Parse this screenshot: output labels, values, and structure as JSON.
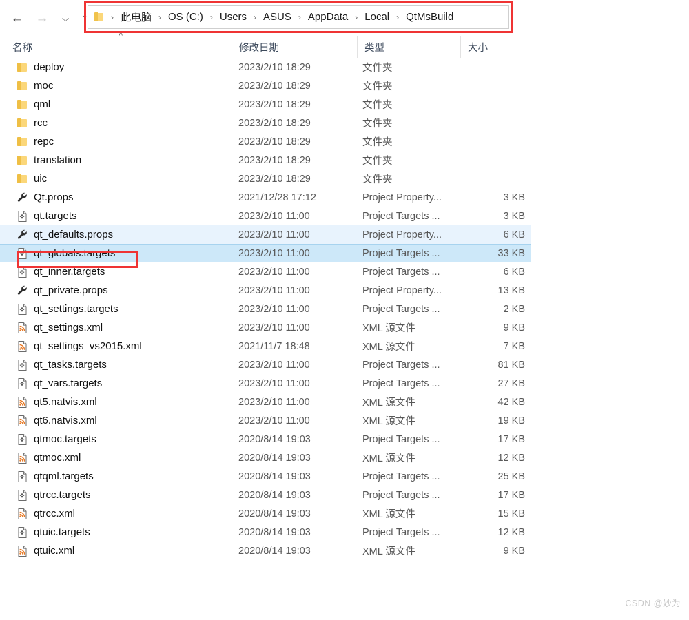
{
  "nav": {
    "back_icon": "arrow-left-icon",
    "forward_icon": "arrow-right-icon",
    "recent_icon": "chevron-down-icon",
    "up_icon": "arrow-up-icon",
    "back_label": "←",
    "forward_label": "→",
    "recent_label": "⌵",
    "up_label": "↑"
  },
  "address": {
    "folder_icon": "folder-icon",
    "separator": "›",
    "crumbs": [
      {
        "label": "此电脑"
      },
      {
        "label": "OS (C:)"
      },
      {
        "label": "Users"
      },
      {
        "label": "ASUS"
      },
      {
        "label": "AppData"
      },
      {
        "label": "Local"
      },
      {
        "label": "QtMsBuild"
      }
    ]
  },
  "columns": {
    "name": "名称",
    "date": "修改日期",
    "type": "类型",
    "size": "大小",
    "sort_caret": "˄"
  },
  "rows": [
    {
      "name": "deploy",
      "date": "2023/2/10 18:29",
      "type": "文件夹",
      "size": "",
      "icon": "folder-icon",
      "kind": "folder",
      "selected": "none"
    },
    {
      "name": "moc",
      "date": "2023/2/10 18:29",
      "type": "文件夹",
      "size": "",
      "icon": "folder-icon",
      "kind": "folder",
      "selected": "none"
    },
    {
      "name": "qml",
      "date": "2023/2/10 18:29",
      "type": "文件夹",
      "size": "",
      "icon": "folder-icon",
      "kind": "folder",
      "selected": "none"
    },
    {
      "name": "rcc",
      "date": "2023/2/10 18:29",
      "type": "文件夹",
      "size": "",
      "icon": "folder-icon",
      "kind": "folder",
      "selected": "none"
    },
    {
      "name": "repc",
      "date": "2023/2/10 18:29",
      "type": "文件夹",
      "size": "",
      "icon": "folder-icon",
      "kind": "folder",
      "selected": "none"
    },
    {
      "name": "translation",
      "date": "2023/2/10 18:29",
      "type": "文件夹",
      "size": "",
      "icon": "folder-icon",
      "kind": "folder",
      "selected": "none"
    },
    {
      "name": "uic",
      "date": "2023/2/10 18:29",
      "type": "文件夹",
      "size": "",
      "icon": "folder-icon",
      "kind": "folder",
      "selected": "none"
    },
    {
      "name": "Qt.props",
      "date": "2021/12/28 17:12",
      "type": "Project Property...",
      "size": "3 KB",
      "icon": "wrench-icon",
      "kind": "props",
      "selected": "none"
    },
    {
      "name": "qt.targets",
      "date": "2023/2/10 11:00",
      "type": "Project Targets ...",
      "size": "3 KB",
      "icon": "targets-file-icon",
      "kind": "targets",
      "selected": "none"
    },
    {
      "name": "qt_defaults.props",
      "date": "2023/2/10 11:00",
      "type": "Project Property...",
      "size": "6 KB",
      "icon": "wrench-icon",
      "kind": "props",
      "selected": "light"
    },
    {
      "name": "qt_globals.targets",
      "date": "2023/2/10 11:00",
      "type": "Project Targets ...",
      "size": "33 KB",
      "icon": "targets-file-icon",
      "kind": "targets",
      "selected": "strong"
    },
    {
      "name": "qt_inner.targets",
      "date": "2023/2/10 11:00",
      "type": "Project Targets ...",
      "size": "6 KB",
      "icon": "targets-file-icon",
      "kind": "targets",
      "selected": "none"
    },
    {
      "name": "qt_private.props",
      "date": "2023/2/10 11:00",
      "type": "Project Property...",
      "size": "13 KB",
      "icon": "wrench-icon",
      "kind": "props",
      "selected": "none"
    },
    {
      "name": "qt_settings.targets",
      "date": "2023/2/10 11:00",
      "type": "Project Targets ...",
      "size": "2 KB",
      "icon": "targets-file-icon",
      "kind": "targets",
      "selected": "none"
    },
    {
      "name": "qt_settings.xml",
      "date": "2023/2/10 11:00",
      "type": "XML 源文件",
      "size": "9 KB",
      "icon": "xml-file-icon",
      "kind": "xml",
      "selected": "none"
    },
    {
      "name": "qt_settings_vs2015.xml",
      "date": "2021/11/7 18:48",
      "type": "XML 源文件",
      "size": "7 KB",
      "icon": "xml-file-icon",
      "kind": "xml",
      "selected": "none"
    },
    {
      "name": "qt_tasks.targets",
      "date": "2023/2/10 11:00",
      "type": "Project Targets ...",
      "size": "81 KB",
      "icon": "targets-file-icon",
      "kind": "targets",
      "selected": "none"
    },
    {
      "name": "qt_vars.targets",
      "date": "2023/2/10 11:00",
      "type": "Project Targets ...",
      "size": "27 KB",
      "icon": "targets-file-icon",
      "kind": "targets",
      "selected": "none"
    },
    {
      "name": "qt5.natvis.xml",
      "date": "2023/2/10 11:00",
      "type": "XML 源文件",
      "size": "42 KB",
      "icon": "xml-file-icon",
      "kind": "xml",
      "selected": "none"
    },
    {
      "name": "qt6.natvis.xml",
      "date": "2023/2/10 11:00",
      "type": "XML 源文件",
      "size": "19 KB",
      "icon": "xml-file-icon",
      "kind": "xml",
      "selected": "none"
    },
    {
      "name": "qtmoc.targets",
      "date": "2020/8/14 19:03",
      "type": "Project Targets ...",
      "size": "17 KB",
      "icon": "targets-file-icon",
      "kind": "targets",
      "selected": "none"
    },
    {
      "name": "qtmoc.xml",
      "date": "2020/8/14 19:03",
      "type": "XML 源文件",
      "size": "12 KB",
      "icon": "xml-file-icon",
      "kind": "xml",
      "selected": "none"
    },
    {
      "name": "qtqml.targets",
      "date": "2020/8/14 19:03",
      "type": "Project Targets ...",
      "size": "25 KB",
      "icon": "targets-file-icon",
      "kind": "targets",
      "selected": "none"
    },
    {
      "name": "qtrcc.targets",
      "date": "2020/8/14 19:03",
      "type": "Project Targets ...",
      "size": "17 KB",
      "icon": "targets-file-icon",
      "kind": "targets",
      "selected": "none"
    },
    {
      "name": "qtrcc.xml",
      "date": "2020/8/14 19:03",
      "type": "XML 源文件",
      "size": "15 KB",
      "icon": "xml-file-icon",
      "kind": "xml",
      "selected": "none"
    },
    {
      "name": "qtuic.targets",
      "date": "2020/8/14 19:03",
      "type": "Project Targets ...",
      "size": "12 KB",
      "icon": "targets-file-icon",
      "kind": "targets",
      "selected": "none"
    },
    {
      "name": "qtuic.xml",
      "date": "2020/8/14 19:03",
      "type": "XML 源文件",
      "size": "9 KB",
      "icon": "xml-file-icon",
      "kind": "xml",
      "selected": "none"
    }
  ],
  "annotations": {
    "address_box": "red-highlight-rectangle",
    "file_box": "red-highlight-rectangle"
  },
  "watermark": "CSDN @妙为",
  "colors": {
    "annotation_red": "#ef3434",
    "selection_light": "#e8f3fd",
    "selection_strong": "#cde8f9",
    "folder_yellow": "#fbd77a",
    "xml_orange": "#e8761f"
  }
}
